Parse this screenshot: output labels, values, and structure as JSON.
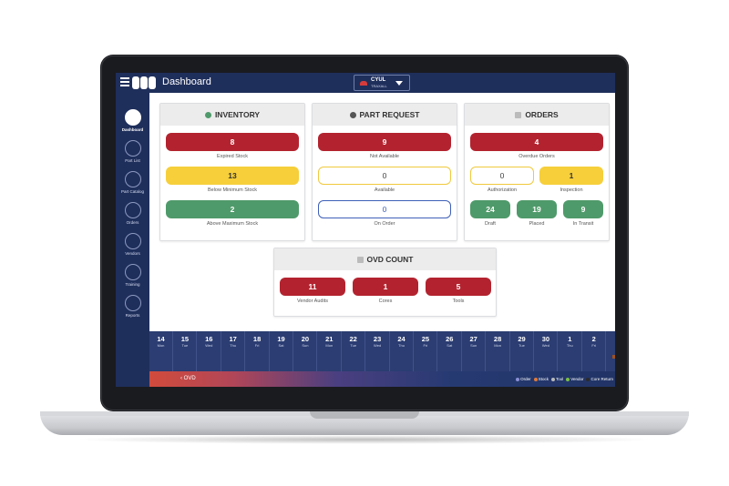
{
  "topbar": {
    "title": "Dashboard",
    "site_code": "CYUL",
    "site_sub": "TRAXALL"
  },
  "sidebar": {
    "items": [
      {
        "label": "Dashboard",
        "icon": "dashboard-icon"
      },
      {
        "label": "Part List",
        "icon": "cart-icon"
      },
      {
        "label": "Part Catalog",
        "icon": "catalog-icon"
      },
      {
        "label": "Orders",
        "icon": "clipboard-icon"
      },
      {
        "label": "Vendors",
        "icon": "vendors-icon"
      },
      {
        "label": "Training",
        "icon": "graduation-cap-icon"
      },
      {
        "label": "Reports",
        "icon": "reports-icon"
      }
    ]
  },
  "inventory": {
    "title": "INVENTORY",
    "tiles": [
      {
        "value": "8",
        "label": "Expired Stock"
      },
      {
        "value": "13",
        "label": "Below Minimum Stock"
      },
      {
        "value": "2",
        "label": "Above Maximum Stock"
      }
    ]
  },
  "part_request": {
    "title": "PART REQUEST",
    "tiles": [
      {
        "value": "9",
        "label": "Not Available"
      },
      {
        "value": "0",
        "label": "Available"
      },
      {
        "value": "0",
        "label": "On Order"
      }
    ]
  },
  "orders": {
    "title": "ORDERS",
    "tiles": [
      {
        "value": "4",
        "label": "Overdue Orders"
      },
      {
        "value": "0",
        "label": "Authorization"
      },
      {
        "value": "1",
        "label": "Inspection"
      },
      {
        "value": "24",
        "label": "Draft"
      },
      {
        "value": "19",
        "label": "Placed"
      },
      {
        "value": "9",
        "label": "In Transit"
      }
    ]
  },
  "ovd_count": {
    "title": "OVD COUNT",
    "tiles": [
      {
        "value": "11",
        "label": "Vendor Audits"
      },
      {
        "value": "1",
        "label": "Cores"
      },
      {
        "value": "5",
        "label": "Tools"
      }
    ]
  },
  "calendar": {
    "days": [
      {
        "n": "14",
        "w": "Mon"
      },
      {
        "n": "15",
        "w": "Tue"
      },
      {
        "n": "16",
        "w": "Wed"
      },
      {
        "n": "17",
        "w": "Thu"
      },
      {
        "n": "18",
        "w": "Fri"
      },
      {
        "n": "19",
        "w": "Sat"
      },
      {
        "n": "20",
        "w": "Sun"
      },
      {
        "n": "21",
        "w": "Mon"
      },
      {
        "n": "22",
        "w": "Tue"
      },
      {
        "n": "23",
        "w": "Wed"
      },
      {
        "n": "24",
        "w": "Thu"
      },
      {
        "n": "25",
        "w": "Fri"
      },
      {
        "n": "26",
        "w": "Sat"
      },
      {
        "n": "27",
        "w": "Sun"
      },
      {
        "n": "28",
        "w": "Mon"
      },
      {
        "n": "29",
        "w": "Tue"
      },
      {
        "n": "30",
        "w": "Wed"
      },
      {
        "n": "1",
        "w": "Thu"
      },
      {
        "n": "2",
        "w": "Fri"
      }
    ]
  },
  "strip": {
    "ovd_label": "OVD"
  },
  "legend": [
    {
      "label": "Order",
      "color": "#8a8fd6"
    },
    {
      "label": "Stock",
      "color": "#e07a3a"
    },
    {
      "label": "Tool",
      "color": "#b9b9b9"
    },
    {
      "label": "Vendor",
      "color": "#7bc043"
    },
    {
      "label": "Core Return",
      "color": "#2b2b2b"
    }
  ],
  "colors": {
    "navy": "#1f2f5c",
    "red": "#b3232f",
    "yellow": "#f6cf3a",
    "green": "#4f9a6a",
    "blue": "#3d5fb8"
  }
}
